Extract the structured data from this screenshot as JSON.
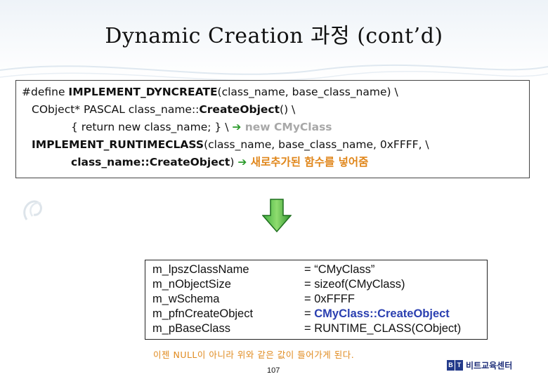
{
  "slide": {
    "title": "Dynamic Creation 과정 (cont’d)",
    "page_number": "107",
    "footnote": "이젠 NULL이 아니라 위와 같은 값이 들어가게 된다.",
    "logo": {
      "box1": "B",
      "box2": "T",
      "text": "비트교육센터"
    }
  },
  "code": {
    "line1": {
      "prefix": "#define ",
      "macro": "IMPLEMENT_DYNCREATE",
      "args": "(class_name, base_class_name) \\"
    },
    "line2": {
      "prefix": "CObject* PASCAL class_name::",
      "func": "CreateObject",
      "suffix": "() \\"
    },
    "line3": {
      "text": "{ return new class_name; } \\ ",
      "arrow": "➔",
      "note": " new CMyClass"
    },
    "line4": {
      "macro": "IMPLEMENT_RUNTIMECLASS",
      "args": "(class_name, base_class_name, 0xFFFF, \\"
    },
    "line5": {
      "expr": "class_name::CreateObject",
      "close": ") ",
      "arrow": "➔",
      "note": " 새로추가된 함수를 넣어줌"
    }
  },
  "members": [
    {
      "name": "m_lpszClassName",
      "value": "= “CMyClass”",
      "highlight": false
    },
    {
      "name": "m_nObjectSize",
      "value": "= sizeof(CMyClass)",
      "highlight": false
    },
    {
      "name": "m_wSchema",
      "value": "= 0xFFFF",
      "highlight": false
    },
    {
      "name": "m_pfnCreateObject",
      "value_prefix": "= ",
      "value": "CMyClass::CreateObject",
      "highlight": true
    },
    {
      "name": "m_pBaseClass",
      "value": "= RUNTIME_CLASS(CObject)",
      "highlight": false
    }
  ],
  "colors": {
    "accent_orange": "#e0861a",
    "arrow_green": "#2b9a2b",
    "highlight_blue": "#2a3fb0"
  },
  "icons": {
    "down_arrow": "down-arrow-icon",
    "inline_arrow": "right-arrow-icon"
  }
}
